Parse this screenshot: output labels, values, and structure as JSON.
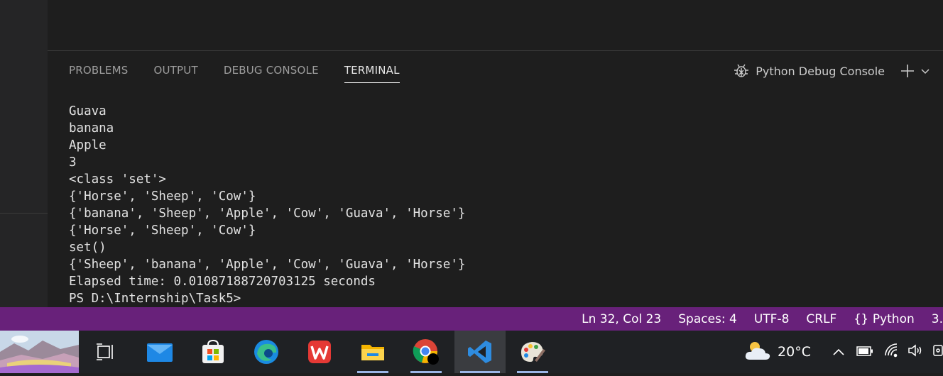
{
  "panel": {
    "tabs": [
      {
        "label": "PROBLEMS"
      },
      {
        "label": "OUTPUT"
      },
      {
        "label": "DEBUG CONSOLE"
      },
      {
        "label": "TERMINAL",
        "active": true
      }
    ],
    "console_selector": "Python Debug Console"
  },
  "terminal": {
    "lines": [
      "Guava",
      "banana",
      "Apple",
      "3",
      "<class 'set'>",
      "{'Horse', 'Sheep', 'Cow'}",
      "{'banana', 'Sheep', 'Apple', 'Cow', 'Guava', 'Horse'}",
      "{'Horse', 'Sheep', 'Cow'}",
      "set()",
      "{'Sheep', 'banana', 'Apple', 'Cow', 'Guava', 'Horse'}",
      "Elapsed time: 0.01087188720703125 seconds",
      "PS D:\\Internship\\Task5>"
    ]
  },
  "statusbar": {
    "position": "Ln 32, Col 23",
    "spaces": "Spaces: 4",
    "encoding": "UTF-8",
    "eol": "CRLF",
    "language": "Python",
    "version_fragment": "3.",
    "background": "#68217a"
  },
  "taskbar": {
    "apps": [
      "task-view-icon",
      "mail-icon",
      "microsoft-store-icon",
      "edge-icon",
      "wps-office-icon",
      "file-explorer-icon",
      "chrome-icon",
      "vscode-icon",
      "paint-icon"
    ],
    "weather": {
      "temperature": "20°C"
    }
  }
}
